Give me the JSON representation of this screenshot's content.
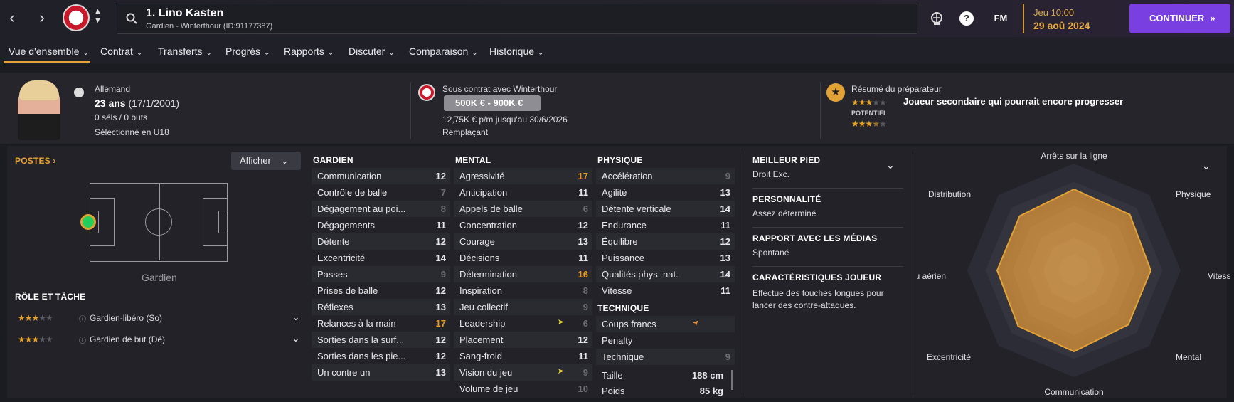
{
  "header": {
    "player_name": "1. Lino Kasten",
    "player_sub": "Gardien - Winterthour (ID:91177387)",
    "fm_label": "FM",
    "date_day": "Jeu 10:00",
    "date_full": "29 aoû 2024",
    "continue_label": "CONTINUER"
  },
  "tabs": [
    {
      "label": "Vue d'ensemble"
    },
    {
      "label": "Contrat"
    },
    {
      "label": "Transferts"
    },
    {
      "label": "Progrès"
    },
    {
      "label": "Rapports"
    },
    {
      "label": "Discuter"
    },
    {
      "label": "Comparaison"
    },
    {
      "label": "Historique"
    }
  ],
  "info": {
    "nationality": "Allemand",
    "age": "23 ans",
    "dob": "(17/1/2001)",
    "caps": "0 séls / 0 buts",
    "selection": "Sélectionné en U18",
    "contract_title": "Sous contrat avec Winterthour",
    "salary": "500K € - 900K €",
    "wage": "12,75K € p/m jusqu'au 30/6/2026",
    "status": "Remplaçant",
    "coach_title": "Résumé du préparateur",
    "coach_summary": "Joueur secondaire qui pourrait encore progresser",
    "potential_label": "POTENTIEL",
    "ability_stars": 3,
    "potential_stars": 3.5
  },
  "positions": {
    "header": "POSTES",
    "show_btn": "Afficher",
    "position_name": "Gardien",
    "role_header": "RÔLE ET TÂCHE",
    "roles": [
      {
        "name": "Gardien-libéro (So)",
        "stars": 3
      },
      {
        "name": "Gardien de but (Dé)",
        "stars": 3
      }
    ]
  },
  "attributes": {
    "goalkeeping": {
      "title": "GARDIEN",
      "items": [
        {
          "name": "Communication",
          "value": "12"
        },
        {
          "name": "Contrôle de balle",
          "value": "7"
        },
        {
          "name": "Dégagement au poi...",
          "value": "8"
        },
        {
          "name": "Dégagements",
          "value": "11"
        },
        {
          "name": "Détente",
          "value": "12"
        },
        {
          "name": "Excentricité",
          "value": "14"
        },
        {
          "name": "Passes",
          "value": "9"
        },
        {
          "name": "Prises de balle",
          "value": "12"
        },
        {
          "name": "Réflexes",
          "value": "13"
        },
        {
          "name": "Relances à la main",
          "value": "17"
        },
        {
          "name": "Sorties dans la surf...",
          "value": "12"
        },
        {
          "name": "Sorties dans les pie...",
          "value": "12"
        },
        {
          "name": "Un contre un",
          "value": "13"
        }
      ]
    },
    "mental": {
      "title": "MENTAL",
      "items": [
        {
          "name": "Agressivité",
          "value": "17"
        },
        {
          "name": "Anticipation",
          "value": "11"
        },
        {
          "name": "Appels de balle",
          "value": "6"
        },
        {
          "name": "Concentration",
          "value": "12"
        },
        {
          "name": "Courage",
          "value": "13"
        },
        {
          "name": "Décisions",
          "value": "11"
        },
        {
          "name": "Détermination",
          "value": "16"
        },
        {
          "name": "Inspiration",
          "value": "8"
        },
        {
          "name": "Jeu collectif",
          "value": "9"
        },
        {
          "name": "Leadership",
          "value": "6"
        },
        {
          "name": "Placement",
          "value": "12"
        },
        {
          "name": "Sang-froid",
          "value": "11"
        },
        {
          "name": "Vision du jeu",
          "value": "9"
        },
        {
          "name": "Volume de jeu",
          "value": "10"
        }
      ]
    },
    "physical": {
      "title": "PHYSIQUE",
      "items": [
        {
          "name": "Accélération",
          "value": "9"
        },
        {
          "name": "Agilité",
          "value": "13"
        },
        {
          "name": "Détente verticale",
          "value": "14"
        },
        {
          "name": "Endurance",
          "value": "11"
        },
        {
          "name": "Équilibre",
          "value": "12"
        },
        {
          "name": "Puissance",
          "value": "13"
        },
        {
          "name": "Qualités phys. nat.",
          "value": "14"
        },
        {
          "name": "Vitesse",
          "value": "11"
        }
      ]
    },
    "technical": {
      "title": "TECHNIQUE",
      "items": [
        {
          "name": "Coups francs",
          "value": ""
        },
        {
          "name": "Penalty",
          "value": ""
        },
        {
          "name": "Technique",
          "value": "9"
        }
      ]
    },
    "height_label": "Taille",
    "height_value": "188 cm",
    "weight_label": "Poids",
    "weight_value": "85 kg"
  },
  "details": {
    "foot_title": "MEILLEUR PIED",
    "foot_value": "Droit Exc.",
    "personality_title": "PERSONNALITÉ",
    "personality_value": "Assez déterminé",
    "media_title": "RAPPORT AVEC LES MÉDIAS",
    "media_value": "Spontané",
    "traits_title": "CARACTÉRISTIQUES JOUEUR",
    "traits_value": "Effectue des touches longues pour lancer des contre-attaques."
  },
  "radar": {
    "labels": [
      "Arrêts sur la ligne",
      "Physique",
      "Vitesse",
      "Mental",
      "Communication",
      "Excentricité",
      "Jeu aérien",
      "Distribution"
    ],
    "values": [
      0.76,
      0.74,
      0.72,
      0.72,
      0.76,
      0.74,
      0.72,
      0.72
    ],
    "fill_color": "#c8883a"
  }
}
